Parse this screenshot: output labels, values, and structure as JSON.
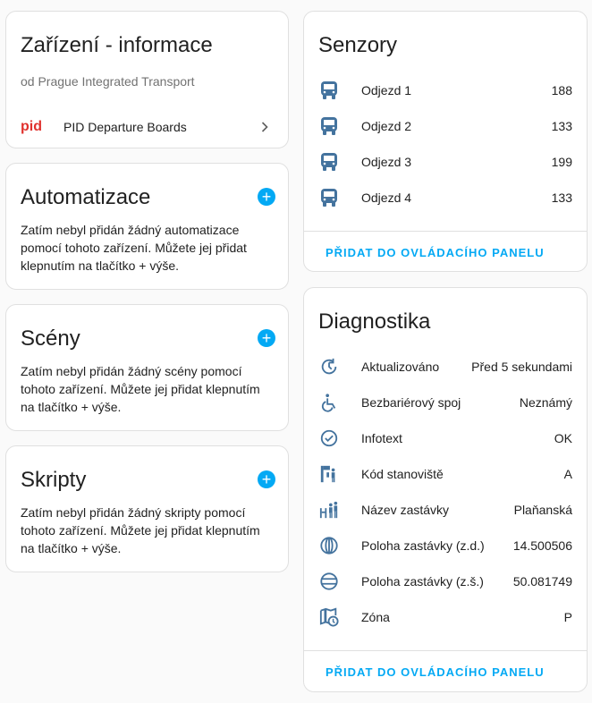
{
  "device_info": {
    "title": "Zařízení - informace",
    "manufacturer": "od Prague Integrated Transport",
    "integration_logo": "pid",
    "integration_name": "PID Departure Boards"
  },
  "automations": {
    "title": "Automatizace",
    "empty_text": "Zatím nebyl přidán žádný automatizace pomocí tohoto zařízení. Můžete jej přidat klepnutím na tlačítko + výše."
  },
  "scenes": {
    "title": "Scény",
    "empty_text": "Zatím nebyl přidán žádný scény pomocí tohoto zařízení. Můžete jej přidat klepnutím na tlačítko + výše."
  },
  "scripts": {
    "title": "Skripty",
    "empty_text": "Zatím nebyl přidán žádný skripty pomocí tohoto zařízení. Můžete jej přidat klepnutím na tlačítko + výše."
  },
  "sensors": {
    "title": "Senzory",
    "items": [
      {
        "icon": "bus-icon",
        "label": "Odjezd 1",
        "value": "188"
      },
      {
        "icon": "bus-icon",
        "label": "Odjezd 2",
        "value": "133"
      },
      {
        "icon": "bus-icon",
        "label": "Odjezd 3",
        "value": "199"
      },
      {
        "icon": "bus-icon",
        "label": "Odjezd 4",
        "value": "133"
      }
    ],
    "action": "PŘIDAT DO OVLÁDACÍHO PANELU"
  },
  "diagnostics": {
    "title": "Diagnostika",
    "items": [
      {
        "icon": "update-icon",
        "label": "Aktualizováno",
        "value": "Před 5 sekundami"
      },
      {
        "icon": "wheelchair-icon",
        "label": "Bezbariérový spoj",
        "value": "Neznámý"
      },
      {
        "icon": "check-circle-icon",
        "label": "Infotext",
        "value": "OK"
      },
      {
        "icon": "stop-code-icon",
        "label": "Kód stanoviště",
        "value": "A"
      },
      {
        "icon": "stop-name-icon",
        "label": "Název zastávky",
        "value": "Plaňanská"
      },
      {
        "icon": "longitude-icon",
        "label": "Poloha zastávky (z.d.)",
        "value": "14.500506"
      },
      {
        "icon": "latitude-icon",
        "label": "Poloha zastávky (z.š.)",
        "value": "50.081749"
      },
      {
        "icon": "map-clock-icon",
        "label": "Zóna",
        "value": "P"
      }
    ],
    "action": "PŘIDAT DO OVLÁDACÍHO PANELU"
  },
  "colors": {
    "accent": "#03a9f4",
    "icon": "#44739e",
    "pid_logo": "#e0312d"
  }
}
